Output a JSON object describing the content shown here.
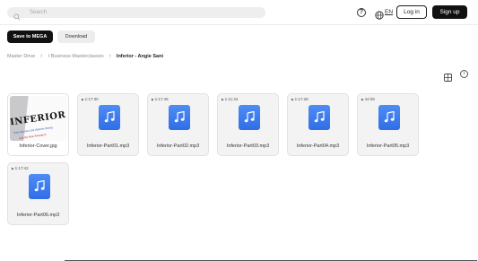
{
  "header": {
    "search_placeholder": "Search",
    "language": "EN",
    "login_label": "Log in",
    "signup_label": "Sign up"
  },
  "toolbar": {
    "save_label": "Save to MEGA",
    "download_label": "Download"
  },
  "breadcrumb": {
    "items": [
      "Master Drive",
      "I Business Masterclasses",
      "Inferior - Angie Sani"
    ]
  },
  "files": [
    {
      "name": "Inferior-Cover.jpg",
      "type": "image",
      "thumb_title": "INFERIOR",
      "thumb_sub1": "How Science Got Women Wrong",
      "thumb_sub2": "and the New Research"
    },
    {
      "name": "Inferior-Part01.mp3",
      "type": "audio",
      "duration": "1:17:30"
    },
    {
      "name": "Inferior-Part02.mp3",
      "type": "audio",
      "duration": "1:17:45"
    },
    {
      "name": "Inferior-Part03.mp3",
      "type": "audio",
      "duration": "1:11:44"
    },
    {
      "name": "Inferior-Part04.mp3",
      "type": "audio",
      "duration": "1:17:28"
    },
    {
      "name": "Inferior-Part05.mp3",
      "type": "audio",
      "duration": "44:05"
    },
    {
      "name": "Inferior-Part06.mp3",
      "type": "audio",
      "duration": "1:17:42"
    }
  ],
  "colors": {
    "accent_dark": "#111111",
    "music_icon_blue": "#2f6ee6"
  }
}
